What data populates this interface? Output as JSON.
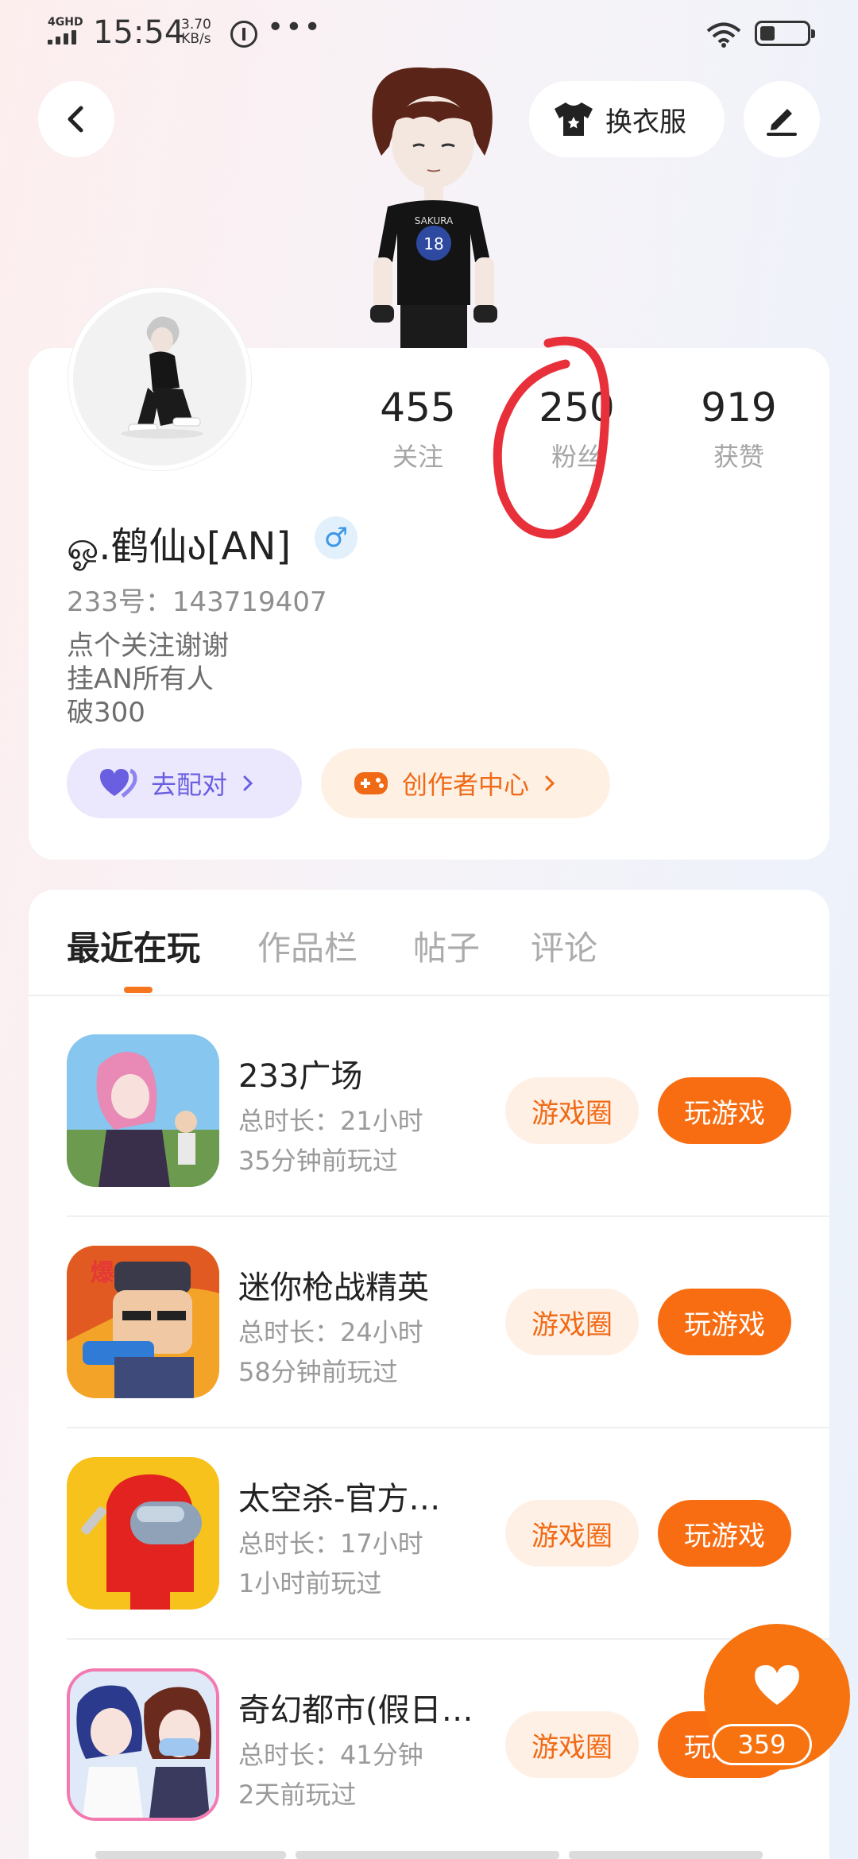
{
  "status_bar": {
    "network": "4GHD",
    "time": "15:54",
    "speed_value": "3.70",
    "speed_unit": "KB/s",
    "more": "•••"
  },
  "header": {
    "back_icon": "chevron-left-icon",
    "outfit_label": "换衣服",
    "outfit_icon": "tshirt-icon",
    "edit_icon": "pen-icon"
  },
  "profile": {
    "stats": [
      {
        "value": "455",
        "label": "关注"
      },
      {
        "value": "250",
        "label": "粉丝"
      },
      {
        "value": "919",
        "label": "获赞"
      }
    ],
    "username": "ஓ.鹤仙ა[AN]",
    "gender_symbol": "♂",
    "uid": "233号：143719407",
    "bio_lines": [
      "点个关注谢谢",
      "挂AN所有人",
      "破300"
    ],
    "match_label": "去配对",
    "creator_label": "创作者中心"
  },
  "tabs": [
    "最近在玩",
    "作品栏",
    "帖子",
    "评论"
  ],
  "games": [
    {
      "name": "233广场",
      "duration": "总时长：21小时",
      "last_played": "35分钟前玩过",
      "circle_label": "游戏圈",
      "play_label": "玩游戏"
    },
    {
      "name": "迷你枪战精英",
      "duration": "总时长：24小时",
      "last_played": "58分钟前玩过",
      "circle_label": "游戏圈",
      "play_label": "玩游戏"
    },
    {
      "name": "太空杀-官方…",
      "duration": "总时长：17小时",
      "last_played": "1小时前玩过",
      "circle_label": "游戏圈",
      "play_label": "玩游戏"
    },
    {
      "name": "奇幻都市(假日…",
      "duration": "总时长：41分钟",
      "last_played": "2天前玩过",
      "circle_label": "游戏圈",
      "play_label": "玩游戏"
    }
  ],
  "fab": {
    "icon": "heart-icon",
    "count": "359"
  },
  "colors": {
    "accent": "#f96d12",
    "accent_light": "#fff0e5",
    "match": "#6a5fe0",
    "annotation": "#e8303a"
  }
}
